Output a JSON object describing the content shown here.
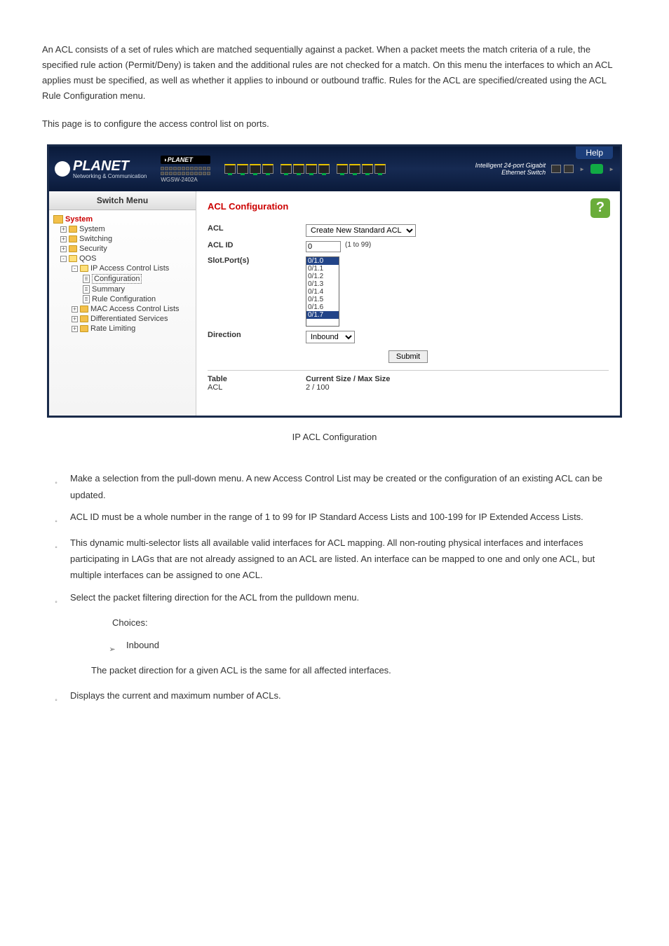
{
  "intro_para": "An ACL consists of a set of rules which are matched sequentially against a packet. When a packet meets the match criteria of a rule, the specified rule action (Permit/Deny) is taken and the additional rules are not checked for a match. On this menu the interfaces to which an ACL applies must be specified, as well as whether it applies to inbound or outbound traffic. Rules for the ACL are specified/created using the ACL Rule Configuration menu.",
  "lead_para": "This page is to configure the access control list on ports.",
  "banner": {
    "brand": "PLANET",
    "tagline": "Networking & Communication",
    "help": "Help",
    "product_desc": "Intelligent 24-port Gigabit Ethernet Switch",
    "model": "WGSW-2402A"
  },
  "sidebar": {
    "title": "Switch Menu",
    "items": {
      "system_root": "System",
      "system": "System",
      "switching": "Switching",
      "security": "Security",
      "qos": "QOS",
      "ip_acl": "IP Access Control Lists",
      "configuration": "Configuration",
      "summary": "Summary",
      "rule_config": "Rule Configuration",
      "mac_acl": "MAC Access Control Lists",
      "diff_serv": "Differentiated Services",
      "rate_limiting": "Rate Limiting"
    }
  },
  "form": {
    "title": "ACL Configuration",
    "acl_label": "ACL",
    "acl_select": "Create New Standard ACL",
    "acl_id_label": "ACL ID",
    "acl_id_value": "0",
    "acl_id_range": "(1 to 99)",
    "slot_label": "Slot.Port(s)",
    "ports": [
      "0/1.0",
      "0/1.1",
      "0/1.2",
      "0/1.3",
      "0/1.4",
      "0/1.5",
      "0/1.6",
      "0/1.7"
    ],
    "direction_label": "Direction",
    "direction_value": "Inbound",
    "submit": "Submit",
    "table_label": "Table",
    "table_value": "ACL",
    "size_label": "Current Size / Max Size",
    "size_value": "2 / 100"
  },
  "caption": "IP ACL Configuration",
  "bullets": {
    "acl": "Make a selection from the pull-down menu. A new Access Control List may be created or the configuration of an existing ACL can be updated.",
    "acl_id": "ACL ID must be a whole number in the range of 1 to 99 for IP Standard Access Lists and 100-199 for IP Extended Access Lists.",
    "slot": "This dynamic multi-selector lists all available valid interfaces for ACL mapping. All non-routing physical interfaces and interfaces participating in LAGs that are not already assigned to an ACL are listed. An interface can be mapped to one and only one ACL, but multiple interfaces can be assigned to one ACL.",
    "direction": "Select the packet filtering direction for the ACL from the pulldown menu.",
    "choices": "Choices:",
    "inbound": "Inbound",
    "direction_note": "The packet direction for a given ACL is the same for all affected interfaces.",
    "table": "Displays the current and maximum number of ACLs."
  }
}
